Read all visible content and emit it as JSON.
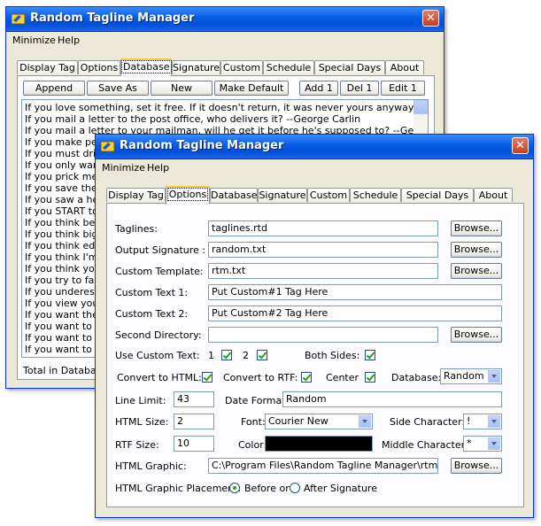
{
  "back": {
    "title": "Random Tagline Manager",
    "close": "✕",
    "menu": [
      "Minimize",
      "Help"
    ],
    "tabs": [
      "Display Tag",
      "Options",
      "Database",
      "Signature",
      "Custom",
      "Schedule",
      "Special Days",
      "About"
    ],
    "active_tab": "Database",
    "buttons": [
      "Append",
      "Save As",
      "New",
      "Make Default",
      "Add 1",
      "Del 1",
      "Edit 1"
    ],
    "lines": [
      "If you love something, set it free. If it doesn't return, it was never yours anyway. If it does, love",
      "If you mail a letter to the post office, who delivers it? --George Carlin",
      "If you mail a letter to your mailman, will he get it before he's supposed to? --George Carlin",
      "If you make peop",
      "If you must drink",
      "If you only want t",
      "If you prick me, d",
      "If you save the w",
      "If you saw a heat",
      "If you START to",
      "If you think befor",
      "If you think big er",
      "If you think educ",
      "If you think I'm sic",
      "If you think you'v",
      "If you try to fail, a",
      "If you underestim",
      "If you view your p",
      "If you want the be",
      "If you want to be",
      "If you want to be",
      "If you want to be"
    ],
    "total_label": "Total in Database"
  },
  "front": {
    "title": "Random Tagline Manager",
    "close": "✕",
    "menu": [
      "Minimize",
      "Help"
    ],
    "tabs": [
      "Display Tag",
      "Options",
      "Database",
      "Signature",
      "Custom",
      "Schedule",
      "Special Days",
      "About"
    ],
    "active_tab": "Options",
    "taglines_label": "Taglines:",
    "taglines_value": "taglines.rtd",
    "output_sig_label": "Output Signature :",
    "output_sig_value": "random.txt",
    "custom_template_label": "Custom Template:",
    "custom_template_value": "rtm.txt",
    "custom_text1_label": "Custom Text 1:",
    "custom_text1_value": "Put Custom#1 Tag Here",
    "custom_text2_label": "Custom Text 2:",
    "custom_text2_value": "Put Custom#2 Tag Here",
    "second_dir_label": "Second Directory:",
    "second_dir_value": "",
    "browse": "Browse...",
    "use_custom_label": "Use Custom Text:",
    "use_custom_1": "1",
    "use_custom_2": "2",
    "both_sides_label": "Both Sides:",
    "convert_html_label": "Convert to HTML:",
    "convert_rtf_label": "Convert to RTF:",
    "center_label": "Center",
    "database_label": "Database:",
    "database_value": "Random",
    "line_limit_label": "Line Limit:",
    "line_limit_value": "43",
    "date_format_label": "Date Format:",
    "date_format_value": "Random",
    "html_size_label": "HTML Size:",
    "html_size_value": "2",
    "font_label": "Font:",
    "font_value": "Courier New",
    "side_char_label": "Side Character:",
    "side_char_value": "!",
    "rtf_size_label": "RTF Size:",
    "rtf_size_value": "10",
    "color_label": "Color:",
    "color_value": "#000000",
    "middle_char_label": "Middle Character:",
    "middle_char_value": "*",
    "html_graphic_label": "HTML Graphic:",
    "html_graphic_value": "C:\\Program Files\\Random Tagline Manager\\rtm.jpg",
    "placement_label": "HTML Graphic Placement:",
    "placement_before": "Before or",
    "placement_after": "After Signature",
    "placement_selected": "Before"
  }
}
